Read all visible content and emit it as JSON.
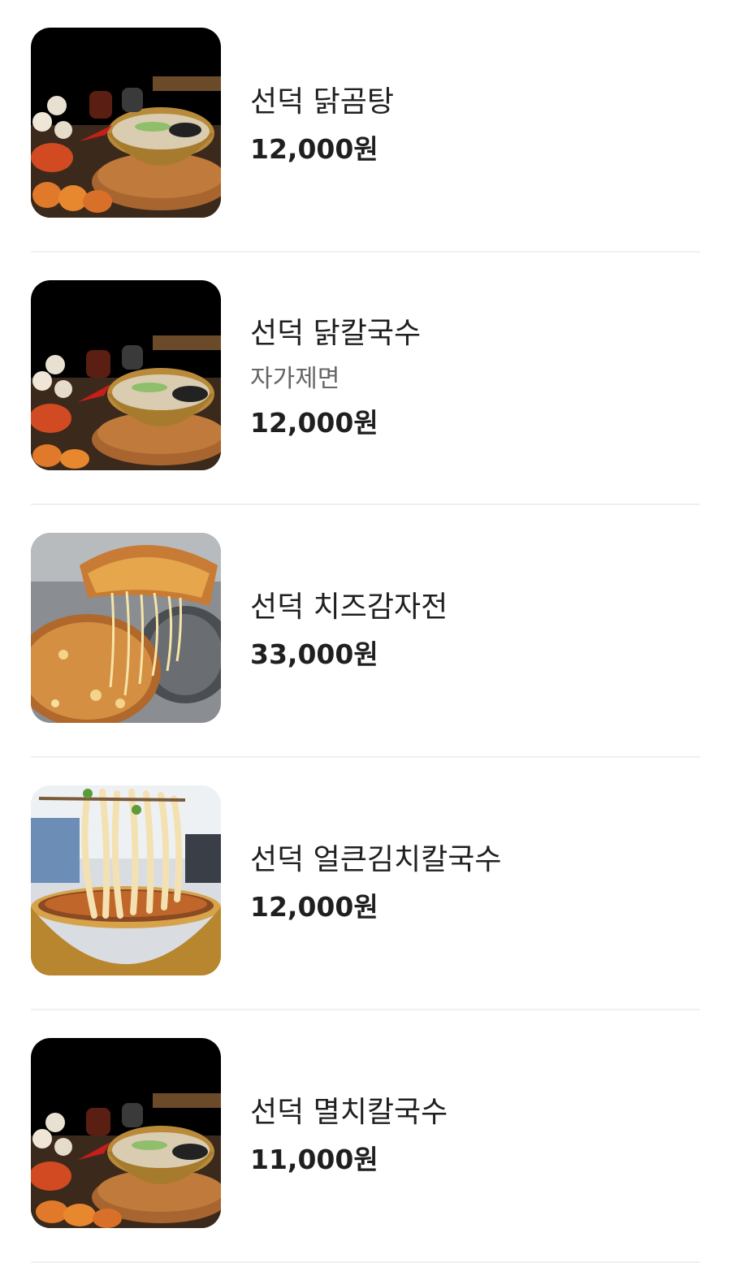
{
  "menu": {
    "items": [
      {
        "name": "선덕 닭곰탕",
        "description": "",
        "price": "12,000원",
        "image": "soup-bowl-image"
      },
      {
        "name": "선덕 닭칼국수",
        "description": "자가제면",
        "price": "12,000원",
        "image": "soup-bowl-image"
      },
      {
        "name": "선덕 치즈감자전",
        "description": "",
        "price": "33,000원",
        "image": "cheese-pancake-image"
      },
      {
        "name": "선덕 얼큰김치칼국수",
        "description": "",
        "price": "12,000원",
        "image": "noodle-lift-image"
      },
      {
        "name": "선덕 멸치칼국수",
        "description": "",
        "price": "11,000원",
        "image": "soup-bowl-image"
      }
    ]
  }
}
